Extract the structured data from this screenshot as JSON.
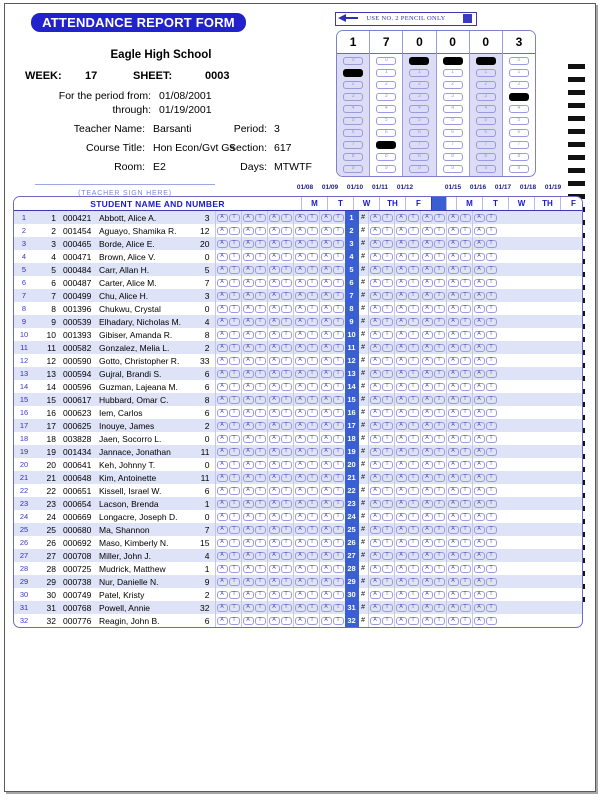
{
  "form": {
    "title": "ATTENDANCE REPORT FORM",
    "school": "Eagle High School",
    "week_label": "WEEK:",
    "week_value": "17",
    "sheet_label": "SHEET:",
    "sheet_value": "0003",
    "period_from_label": "For the period from:",
    "period_from_value": "01/08/2001",
    "through_label": "through:",
    "through_value": "01/19/2001",
    "teacher_label": "Teacher Name:",
    "teacher_value": "Barsanti",
    "course_label": "Course Title:",
    "course_value": "Hon Econ/Gvt Gs",
    "room_label": "Room:",
    "room_value": "E2",
    "period_label": "Period:",
    "period_value": "3",
    "section_label": "Section:",
    "section_value": "617",
    "days_label": "Days:",
    "days_value": "MTWTF",
    "signature_hint": "(TEACHER SIGN HERE)"
  },
  "pencil_banner": {
    "text": "USE NO. 2 PENCIL ONLY",
    "arrow_icon": "pencil-arrow-icon"
  },
  "bubble_grid": {
    "digits": [
      "0",
      "1",
      "2",
      "3",
      "4",
      "5",
      "6",
      "7",
      "8",
      "9"
    ],
    "columns": [
      {
        "value": "1",
        "shaded": true
      },
      {
        "value": "7",
        "shaded": false
      },
      {
        "value": "0",
        "shaded": true
      },
      {
        "value": "0",
        "shaded": false
      },
      {
        "value": "0",
        "shaded": true
      },
      {
        "value": "3",
        "shaded": false
      }
    ]
  },
  "table": {
    "name_header": "STUDENT NAME AND NUMBER",
    "week1_dates": [
      "01/08",
      "01/09",
      "01/10",
      "01/11",
      "01/12"
    ],
    "week2_dates": [
      "01/15",
      "01/16",
      "01/17",
      "01/18",
      "01/19"
    ],
    "day_headers": [
      "M",
      "T",
      "W",
      "TH",
      "F"
    ],
    "mark_absent": "A",
    "mark_tardy": "T",
    "hash_symbol": "#",
    "rows": [
      {
        "idx": "1",
        "seq": "1",
        "id": "000421",
        "name": "Abbott, Alice A.",
        "absences": "3"
      },
      {
        "idx": "2",
        "seq": "2",
        "id": "001454",
        "name": "Aguayo, Shamika R.",
        "absences": "12"
      },
      {
        "idx": "3",
        "seq": "3",
        "id": "000465",
        "name": "Borde, Alice E.",
        "absences": "20"
      },
      {
        "idx": "4",
        "seq": "4",
        "id": "000471",
        "name": "Brown, Alice V.",
        "absences": "0"
      },
      {
        "idx": "5",
        "seq": "5",
        "id": "000484",
        "name": "Carr, Allan H.",
        "absences": "5"
      },
      {
        "idx": "6",
        "seq": "6",
        "id": "000487",
        "name": "Carter, Alice M.",
        "absences": "7"
      },
      {
        "idx": "7",
        "seq": "7",
        "id": "000499",
        "name": "Chu, Alice H.",
        "absences": "3"
      },
      {
        "idx": "8",
        "seq": "8",
        "id": "001396",
        "name": "Chukwu, Crystal",
        "absences": "0"
      },
      {
        "idx": "9",
        "seq": "9",
        "id": "000539",
        "name": "Elhadary, Nicholas M.",
        "absences": "4"
      },
      {
        "idx": "10",
        "seq": "10",
        "id": "001393",
        "name": "Gibiser, Amanda R.",
        "absences": "8"
      },
      {
        "idx": "11",
        "seq": "11",
        "id": "000582",
        "name": "Gonzalez, Melia L.",
        "absences": "2"
      },
      {
        "idx": "12",
        "seq": "12",
        "id": "000590",
        "name": "Gotto, Christopher R.",
        "absences": "33"
      },
      {
        "idx": "13",
        "seq": "13",
        "id": "000594",
        "name": "Gujral, Brandi S.",
        "absences": "6"
      },
      {
        "idx": "14",
        "seq": "14",
        "id": "000596",
        "name": "Guzman, Lajeana M.",
        "absences": "6"
      },
      {
        "idx": "15",
        "seq": "15",
        "id": "000617",
        "name": "Hubbard, Omar C.",
        "absences": "8"
      },
      {
        "idx": "16",
        "seq": "16",
        "id": "000623",
        "name": "Iem, Carlos",
        "absences": "6"
      },
      {
        "idx": "17",
        "seq": "17",
        "id": "000625",
        "name": "Inouye, James",
        "absences": "2"
      },
      {
        "idx": "18",
        "seq": "18",
        "id": "003828",
        "name": "Jaen, Socorro L.",
        "absences": "0"
      },
      {
        "idx": "19",
        "seq": "19",
        "id": "001434",
        "name": "Jannace, Jonathan",
        "absences": "11"
      },
      {
        "idx": "20",
        "seq": "20",
        "id": "000641",
        "name": "Keh, Johnny T.",
        "absences": "0"
      },
      {
        "idx": "21",
        "seq": "21",
        "id": "000648",
        "name": "Kim, Antoinette",
        "absences": "11"
      },
      {
        "idx": "22",
        "seq": "22",
        "id": "000651",
        "name": "Kissell, Israel W.",
        "absences": "6"
      },
      {
        "idx": "23",
        "seq": "23",
        "id": "000654",
        "name": "Lacson, Brenda",
        "absences": "1"
      },
      {
        "idx": "24",
        "seq": "24",
        "id": "000669",
        "name": "Longacre, Joseph D.",
        "absences": "0"
      },
      {
        "idx": "25",
        "seq": "25",
        "id": "000680",
        "name": "Ma, Shannon",
        "absences": "7"
      },
      {
        "idx": "26",
        "seq": "26",
        "id": "000692",
        "name": "Maso, Kimberly N.",
        "absences": "15"
      },
      {
        "idx": "27",
        "seq": "27",
        "id": "000708",
        "name": "Miller, John J.",
        "absences": "4"
      },
      {
        "idx": "28",
        "seq": "28",
        "id": "000725",
        "name": "Mudrick, Matthew",
        "absences": "1"
      },
      {
        "idx": "29",
        "seq": "29",
        "id": "000738",
        "name": "Nur, Danielle N.",
        "absences": "9"
      },
      {
        "idx": "30",
        "seq": "30",
        "id": "000749",
        "name": "Patel, Kristy",
        "absences": "2"
      },
      {
        "idx": "31",
        "seq": "31",
        "id": "000768",
        "name": "Powell, Annie",
        "absences": "32"
      },
      {
        "idx": "32",
        "seq": "32",
        "id": "000776",
        "name": "Reagin, John B.",
        "absences": "6"
      }
    ]
  },
  "colors": {
    "brand_blue": "#2222cc",
    "header_text": "#1a1acc",
    "row_alt": "#dfe3f7",
    "separator": "#3a5fd0",
    "bubble_shade": "#dcdcf5"
  }
}
